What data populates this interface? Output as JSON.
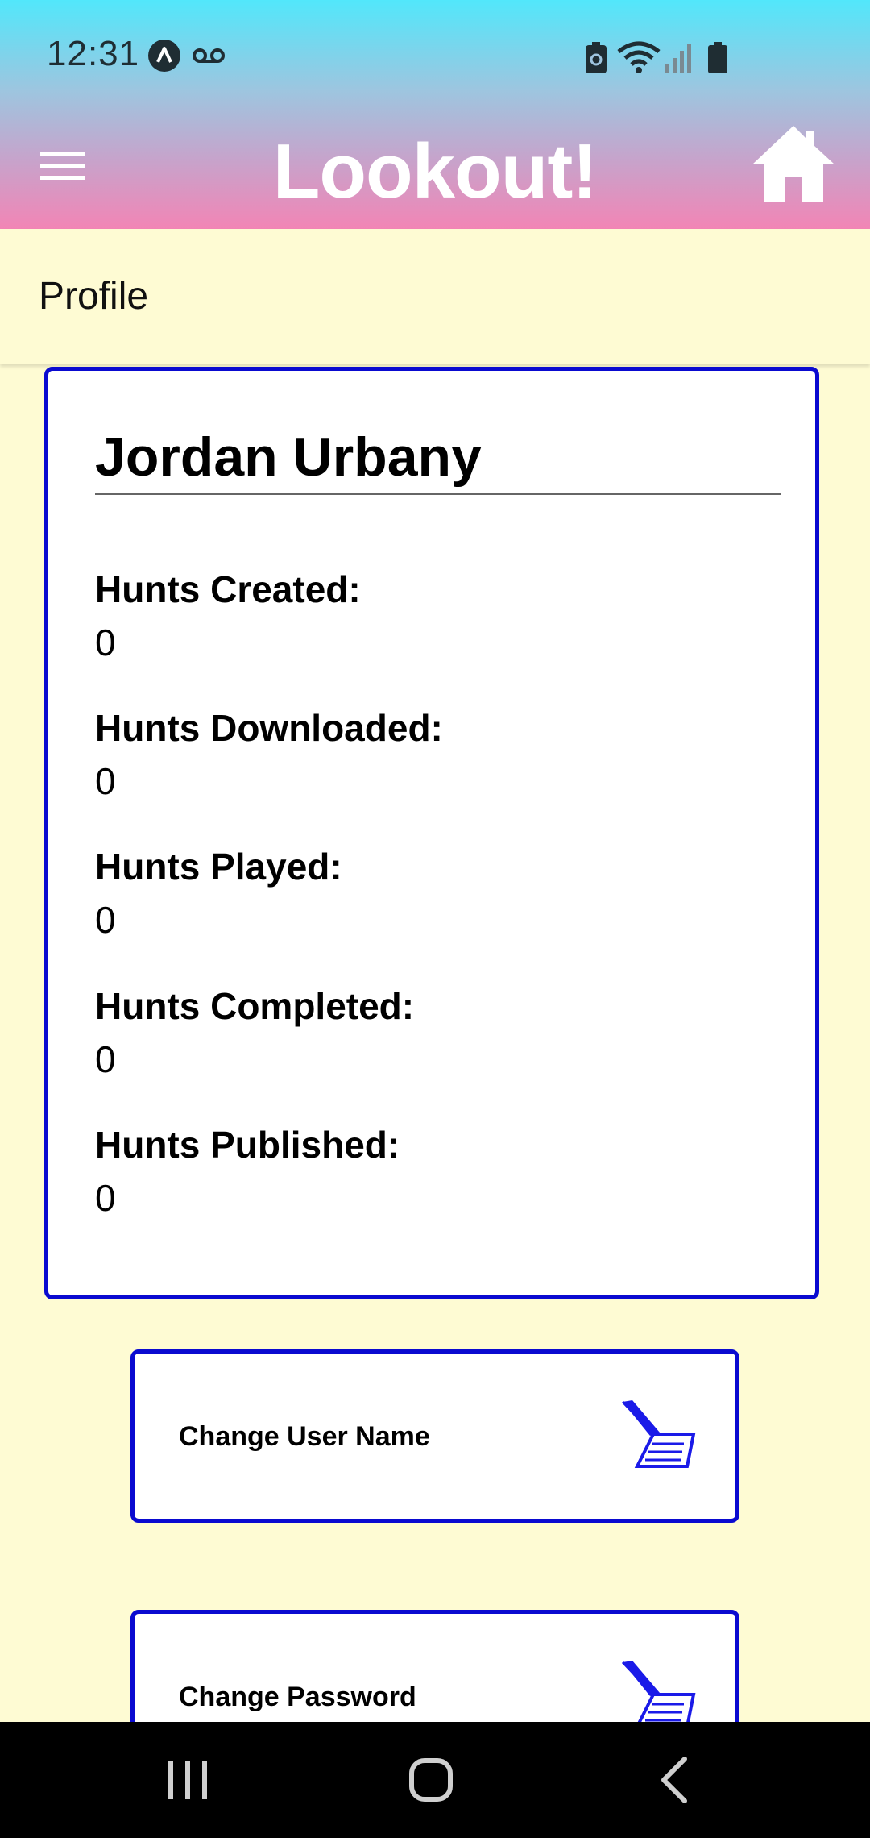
{
  "status_bar": {
    "time": "12:31",
    "icons": [
      "app-notification-icon",
      "voicemail-icon",
      "battery-saver-icon",
      "wifi-icon",
      "signal-icon",
      "battery-icon"
    ]
  },
  "app_bar": {
    "title": "Lookout!",
    "menu_icon": "hamburger-menu-icon",
    "home_icon": "home-icon"
  },
  "page": {
    "title": "Profile"
  },
  "profile": {
    "name": "Jordan Urbany",
    "stats": [
      {
        "label": "Hunts Created:",
        "value": "0"
      },
      {
        "label": "Hunts Downloaded:",
        "value": "0"
      },
      {
        "label": "Hunts Played:",
        "value": "0"
      },
      {
        "label": "Hunts Completed:",
        "value": "0"
      },
      {
        "label": "Hunts Published:",
        "value": "0"
      }
    ]
  },
  "actions": {
    "change_user_name": "Change User Name",
    "change_password": "Change Password",
    "icon": "edit-form-icon"
  },
  "nav_bar": {
    "icons": [
      "recent-apps-icon",
      "home-nav-icon",
      "back-icon"
    ]
  },
  "colors": {
    "accent_border": "#0a0ad0",
    "page_background": "#fefbd3",
    "header_gradient_top": "#52e7fb",
    "header_gradient_bottom": "#f285b5"
  }
}
